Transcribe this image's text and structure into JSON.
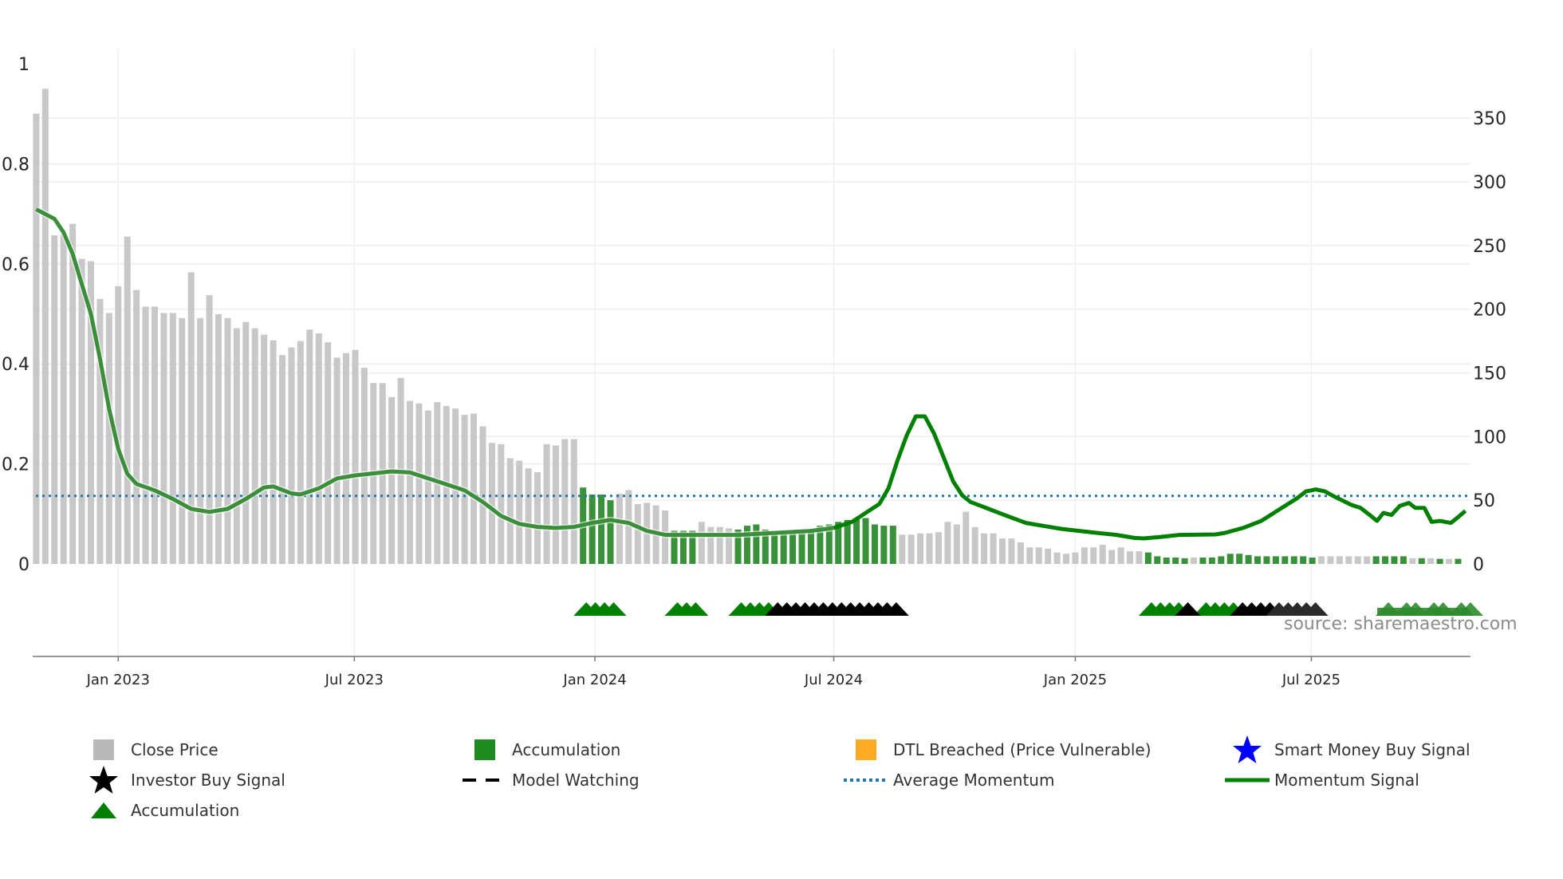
{
  "chart_data": {
    "type": "bar",
    "title": "",
    "x_unit": "week index",
    "left_axis": {
      "ticks": [
        "0",
        "0.2",
        "0.4",
        "0.6",
        "0.8",
        "1"
      ],
      "tick_values": [
        0,
        0.2,
        0.4,
        0.6,
        0.8,
        1
      ],
      "range": [
        0,
        1
      ]
    },
    "right_axis": {
      "ticks": [
        "0",
        "50",
        "100",
        "150",
        "200",
        "250",
        "300",
        "350"
      ],
      "tick_values": [
        0,
        50,
        100,
        150,
        200,
        250,
        300,
        350
      ],
      "range": [
        0,
        392.6
      ]
    },
    "x_ticks": [
      {
        "label": "Jan 2023",
        "week": 9.0
      },
      {
        "label": "Jul 2023",
        "week": 34.9
      },
      {
        "label": "Jan 2024",
        "week": 61.3
      },
      {
        "label": "Jul 2024",
        "week": 87.5
      },
      {
        "label": "Jan 2025",
        "week": 114.0
      },
      {
        "label": "Jul 2025",
        "week": 139.9
      }
    ],
    "close_price": [
      353.5,
      373,
      258,
      259,
      267,
      239.5,
      237.6,
      208,
      197,
      218,
      257,
      215,
      202,
      202,
      197,
      197,
      193,
      229,
      193,
      211,
      196,
      193,
      185,
      190,
      185,
      180,
      175.5,
      164,
      170,
      175,
      184,
      181,
      174,
      162,
      165.5,
      168,
      154,
      142,
      142,
      131,
      146,
      128,
      126,
      120.5,
      127,
      124,
      122,
      117,
      118,
      108,
      95,
      94,
      83,
      81,
      75,
      72,
      94,
      93,
      98,
      98,
      60,
      54.5,
      54.5,
      50,
      55,
      58,
      47,
      48,
      46,
      42,
      26,
      26,
      26,
      33,
      29,
      29,
      28,
      27,
      30,
      31,
      27,
      25,
      26,
      26,
      27,
      27,
      30,
      31,
      33,
      34.5,
      36,
      36,
      31,
      30,
      30,
      23,
      23,
      24,
      24,
      25,
      33,
      31,
      41,
      29,
      24,
      24,
      20,
      20,
      17,
      13,
      13,
      12,
      9,
      8,
      9,
      13,
      13,
      15,
      11,
      13,
      10,
      10,
      9,
      6,
      5,
      5,
      4.5,
      5,
      5,
      5,
      6,
      8,
      8,
      7,
      6,
      6,
      6,
      6,
      6,
      6,
      5,
      6,
      6,
      6,
      6,
      6,
      6,
      6,
      6,
      6,
      6,
      4.5,
      4.5,
      4.5,
      4,
      4,
      4
    ],
    "accumulation_ranges": [
      [
        60,
        63
      ],
      [
        70,
        72
      ],
      [
        77,
        94
      ],
      [
        122,
        126
      ],
      [
        128,
        140
      ],
      [
        147,
        150
      ],
      [
        152,
        152
      ],
      [
        154,
        154
      ],
      [
        156,
        156
      ]
    ],
    "momentum": [
      [
        0,
        0.709
      ],
      [
        2,
        0.69
      ],
      [
        3,
        0.663
      ],
      [
        4,
        0.62
      ],
      [
        5,
        0.56
      ],
      [
        6,
        0.5
      ],
      [
        7,
        0.41
      ],
      [
        8,
        0.31
      ],
      [
        9,
        0.23
      ],
      [
        10,
        0.18
      ],
      [
        11,
        0.16
      ],
      [
        13,
        0.147
      ],
      [
        15,
        0.13
      ],
      [
        17,
        0.11
      ],
      [
        19,
        0.104
      ],
      [
        21,
        0.11
      ],
      [
        23,
        0.13
      ],
      [
        25,
        0.153
      ],
      [
        26,
        0.155
      ],
      [
        28,
        0.141
      ],
      [
        29,
        0.139
      ],
      [
        31,
        0.151
      ],
      [
        33,
        0.171
      ],
      [
        35,
        0.177
      ],
      [
        37,
        0.181
      ],
      [
        39,
        0.185
      ],
      [
        41,
        0.183
      ],
      [
        43,
        0.171
      ],
      [
        45,
        0.159
      ],
      [
        47,
        0.147
      ],
      [
        49,
        0.124
      ],
      [
        51,
        0.096
      ],
      [
        53,
        0.08
      ],
      [
        55,
        0.074
      ],
      [
        57,
        0.072
      ],
      [
        59,
        0.074
      ],
      [
        61,
        0.082
      ],
      [
        63,
        0.088
      ],
      [
        65,
        0.082
      ],
      [
        67,
        0.066
      ],
      [
        69,
        0.058
      ],
      [
        73,
        0.058
      ],
      [
        77,
        0.058
      ],
      [
        81,
        0.062
      ],
      [
        85,
        0.066
      ],
      [
        87.5,
        0.072
      ],
      [
        89.5,
        0.084
      ],
      [
        91.5,
        0.108
      ],
      [
        92.5,
        0.12
      ],
      [
        93.5,
        0.151
      ],
      [
        94.5,
        0.207
      ],
      [
        95.5,
        0.257
      ],
      [
        96.5,
        0.295
      ],
      [
        97.5,
        0.295
      ],
      [
        98.5,
        0.261
      ],
      [
        99.6,
        0.211
      ],
      [
        100.6,
        0.165
      ],
      [
        101.6,
        0.137
      ],
      [
        102.5,
        0.124
      ],
      [
        104.5,
        0.11
      ],
      [
        106.5,
        0.096
      ],
      [
        108.6,
        0.082
      ],
      [
        110.5,
        0.076
      ],
      [
        112.5,
        0.07
      ],
      [
        116.4,
        0.062
      ],
      [
        118.5,
        0.058
      ],
      [
        120.5,
        0.052
      ],
      [
        121.5,
        0.051
      ],
      [
        123.4,
        0.054
      ],
      [
        125.4,
        0.058
      ],
      [
        129.4,
        0.059
      ],
      [
        130.4,
        0.062
      ],
      [
        132.4,
        0.072
      ],
      [
        134.4,
        0.086
      ],
      [
        136.3,
        0.108
      ],
      [
        138.3,
        0.131
      ],
      [
        139.3,
        0.145
      ],
      [
        140.4,
        0.149
      ],
      [
        141.4,
        0.145
      ],
      [
        142.4,
        0.135
      ],
      [
        144.3,
        0.118
      ],
      [
        145.3,
        0.112
      ],
      [
        146.3,
        0.098
      ],
      [
        147.1,
        0.086
      ],
      [
        147.8,
        0.102
      ],
      [
        148.7,
        0.098
      ],
      [
        149.6,
        0.116
      ],
      [
        150.6,
        0.122
      ],
      [
        151.3,
        0.112
      ],
      [
        152.3,
        0.112
      ],
      [
        153.1,
        0.084
      ],
      [
        154.0,
        0.086
      ],
      [
        155.2,
        0.082
      ],
      [
        155.9,
        0.092
      ],
      [
        156.8,
        0.106
      ]
    ],
    "average_momentum": 0.136,
    "accumulation_markers": [
      60,
      61,
      62,
      63,
      70,
      71,
      72,
      77,
      78,
      79,
      80,
      122,
      123,
      124,
      125,
      128,
      129,
      130,
      131
    ],
    "investor_markers": [
      81,
      82,
      83,
      84,
      85,
      86,
      87,
      88,
      89,
      90,
      91,
      92,
      93,
      94,
      126,
      132,
      133,
      134,
      135,
      136,
      137,
      138,
      139,
      140
    ],
    "faded_accumulation_markers": [
      148,
      150,
      151,
      153,
      154,
      156,
      157
    ],
    "colors": {
      "close_price": "#c8c8c8",
      "accumulation": "#2e8b2e",
      "dtl": "#ffab24",
      "smart_money": "#0000ff",
      "investor": "#000000",
      "avg_momentum": "#1f77b4",
      "momentum": "#008000"
    },
    "source": "source: sharemaestro.com",
    "legend": [
      {
        "label": "Close Price",
        "icon": "gray-square"
      },
      {
        "label": "Accumulation",
        "icon": "green-square"
      },
      {
        "label": "DTL Breached (Price Vulnerable)",
        "icon": "orange-square"
      },
      {
        "label": "Smart Money Buy Signal",
        "icon": "blue-star"
      },
      {
        "label": "Investor Buy Signal",
        "icon": "black-star"
      },
      {
        "label": "Model Watching",
        "icon": "black-dashes"
      },
      {
        "label": "Average Momentum",
        "icon": "blue-dotted-line"
      },
      {
        "label": "Momentum Signal",
        "icon": "green-line"
      },
      {
        "label": "Accumulation",
        "icon": "green-triangle"
      }
    ]
  }
}
